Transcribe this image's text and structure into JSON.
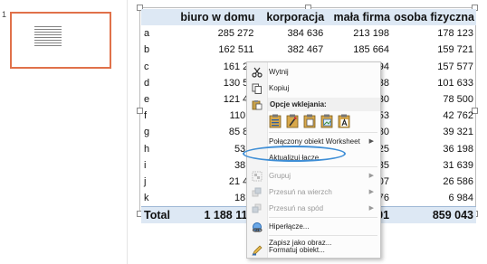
{
  "thumbnail": {
    "slide_number": "1"
  },
  "sheet": {
    "headers": [
      "",
      "biuro w domu",
      "korporacja",
      "mała firma",
      "osoba fizyczna"
    ],
    "rows": [
      [
        "a",
        "285 272",
        "384 636",
        "213 198",
        "178 123"
      ],
      [
        "b",
        "162 511",
        "382 467",
        "185 664",
        "159 721"
      ],
      [
        "c",
        "161 28",
        "",
        "794",
        "157 577"
      ],
      [
        "d",
        "130 59",
        "",
        "738",
        "101 633"
      ],
      [
        "e",
        "121 49",
        "",
        "330",
        "78 500"
      ],
      [
        "f",
        "110 0",
        "",
        "753",
        "42 762"
      ],
      [
        "g",
        "85 85",
        "",
        "180",
        "39 321"
      ],
      [
        "h",
        "53 0",
        "",
        "325",
        "36 198"
      ],
      [
        "i",
        "38 2",
        "",
        "335",
        "31 639"
      ],
      [
        "j",
        "21 40",
        "",
        "107",
        "26 586"
      ],
      [
        "k",
        "18 3",
        "",
        "76",
        "6 984"
      ]
    ],
    "total": [
      "Total",
      "1 188 113",
      "",
      "91",
      "859 043"
    ]
  },
  "context_menu": {
    "cut": "Wytnij",
    "copy": "Kopiuj",
    "paste_options": "Opcje wklejania:",
    "linked_object": "Połączony obiekt Worksheet",
    "update_link": "Aktualizuj łącze",
    "group": "Grupuj",
    "bring_forward": "Przesuń na wierzch",
    "send_backward": "Przesuń na spód",
    "hyperlink": "Hiperłącze...",
    "save_as_picture": "Zapisz jako obraz...",
    "format_object": "Formatuj obiekt..."
  },
  "colors": {
    "thumbnail_selection": "#e0714a",
    "table_header": "#dde8f4",
    "annotation_ring": "#3e8ed6"
  }
}
